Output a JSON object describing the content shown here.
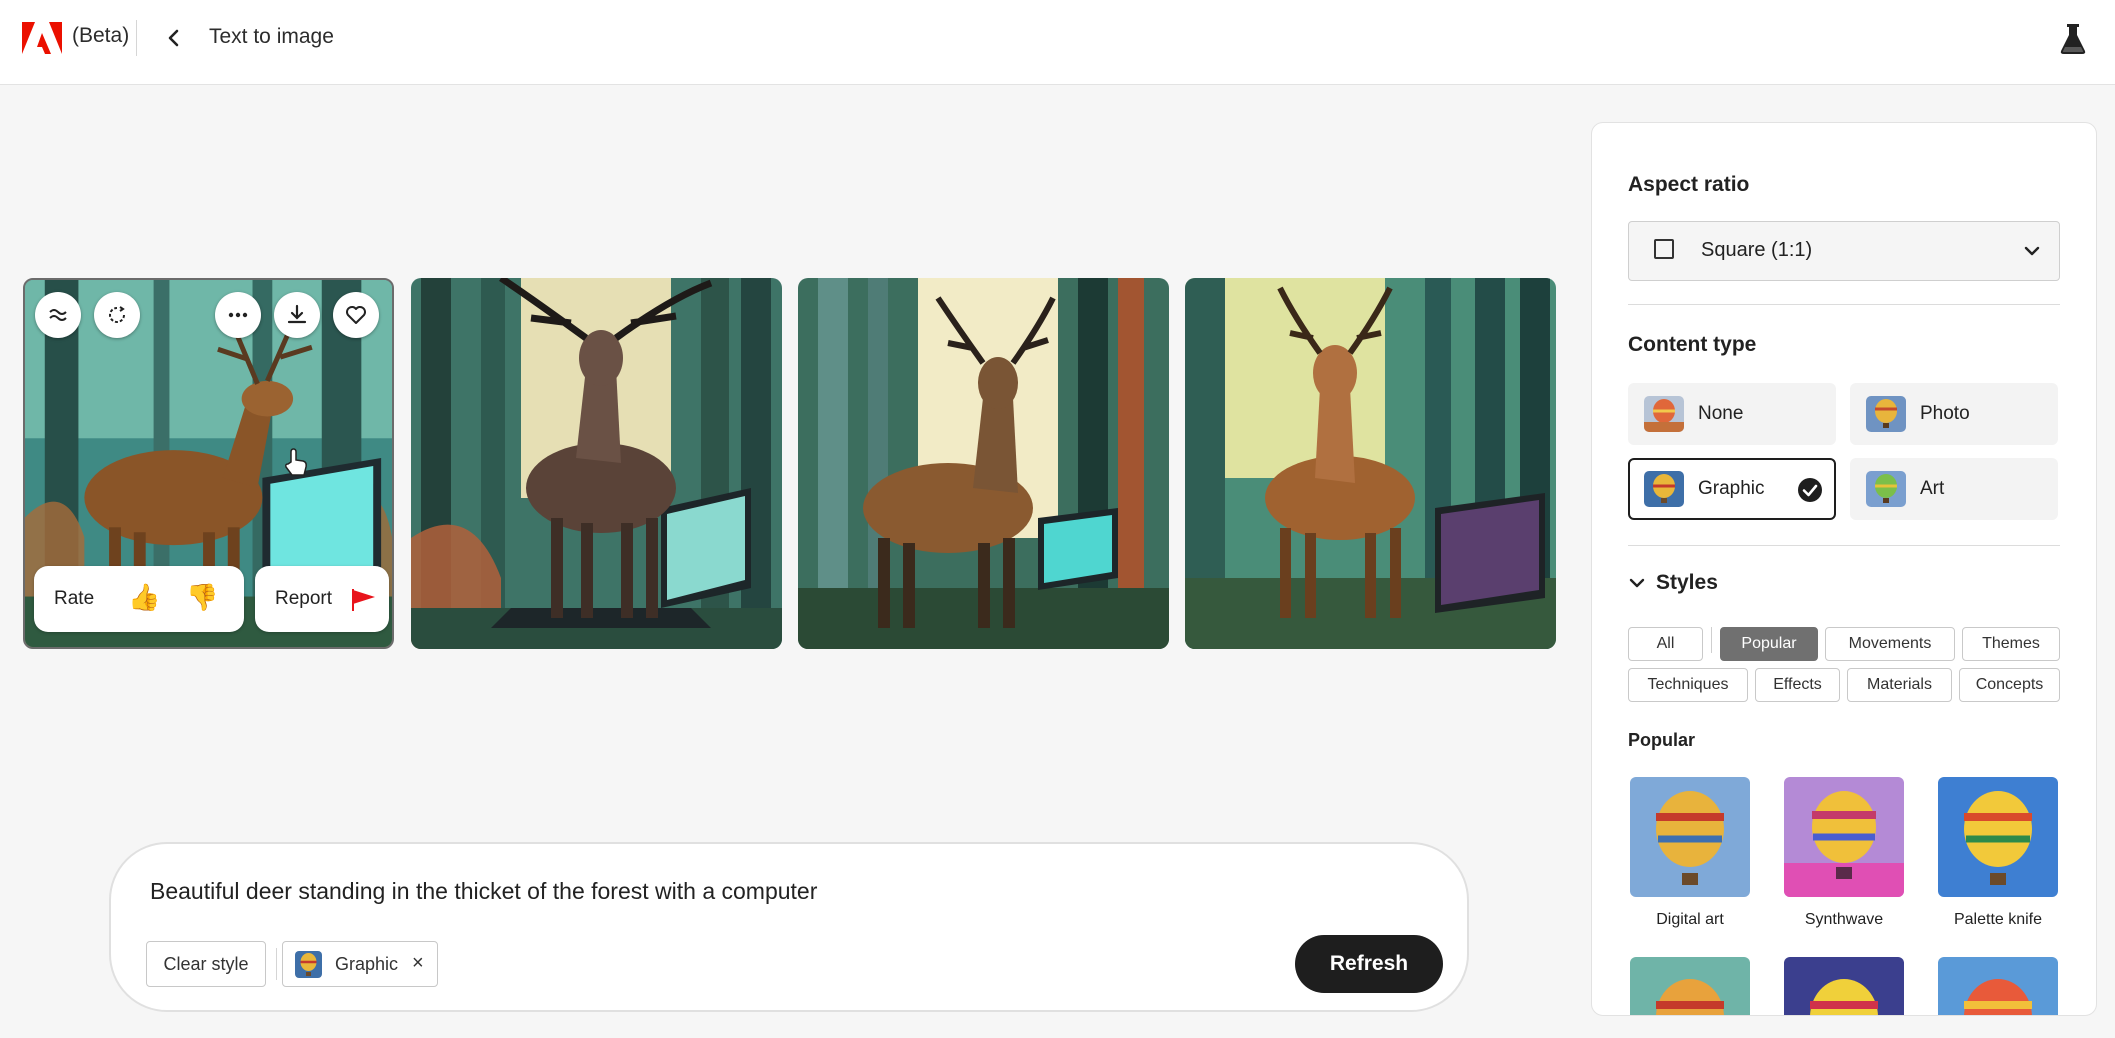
{
  "header": {
    "beta_label": "(Beta)",
    "page_title": "Text to image"
  },
  "image_card": {
    "rate_label": "Rate",
    "report_label": "Report"
  },
  "prompt": {
    "text": "Beautiful deer standing in the thicket of the forest with a computer",
    "clear_style_label": "Clear style",
    "style_chip_label": "Graphic",
    "remove_symbol": "×",
    "refresh_label": "Refresh"
  },
  "panel": {
    "aspect_ratio_title": "Aspect ratio",
    "aspect_ratio_value": "Square (1:1)",
    "content_type_title": "Content type",
    "content_types": [
      {
        "label": "None",
        "selected": false
      },
      {
        "label": "Photo",
        "selected": false
      },
      {
        "label": "Graphic",
        "selected": true
      },
      {
        "label": "Art",
        "selected": false
      }
    ],
    "styles_title": "Styles",
    "style_tabs": [
      "All",
      "Popular",
      "Movements",
      "Themes",
      "Techniques",
      "Effects",
      "Materials",
      "Concepts"
    ],
    "active_style_tab": "Popular",
    "popular_title": "Popular",
    "popular_styles": [
      {
        "label": "Digital art"
      },
      {
        "label": "Synthwave"
      },
      {
        "label": "Palette knife"
      }
    ]
  },
  "colors": {
    "adobe_red": "#eb1000",
    "primary_button": "#1e1e1e",
    "active_tag": "#707070",
    "page_background": "#f6f6f6"
  }
}
